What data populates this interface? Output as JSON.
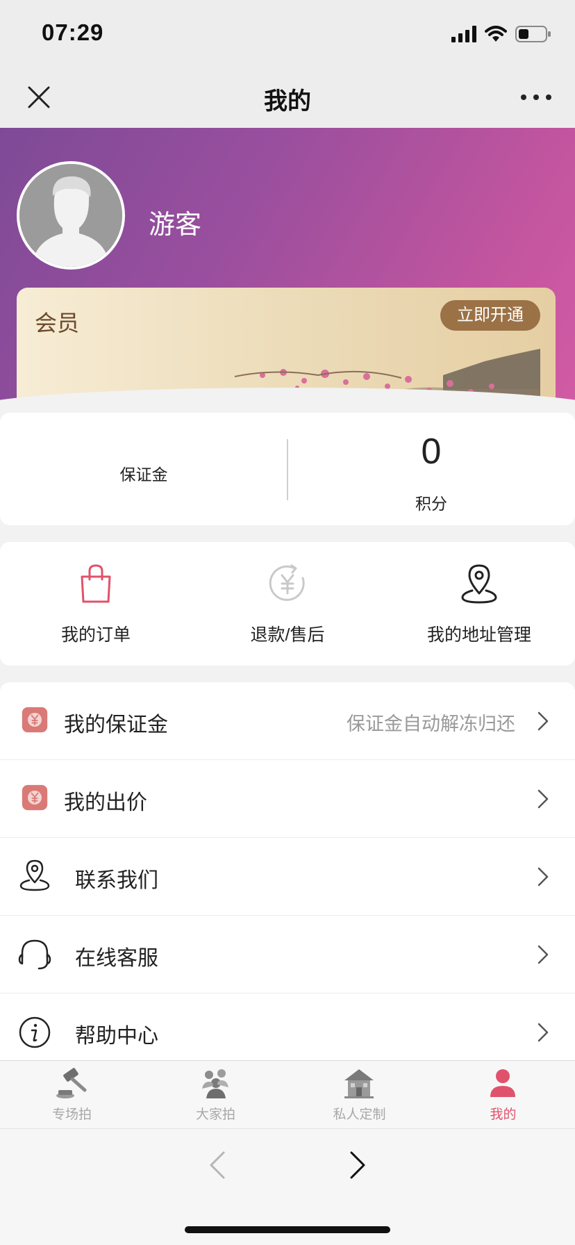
{
  "status_bar": {
    "time": "07:29"
  },
  "nav": {
    "title": "我的"
  },
  "profile": {
    "username": "游客"
  },
  "member_card": {
    "label": "会员",
    "button_label": "立即开通"
  },
  "stats": {
    "deposit": {
      "label": "保证金",
      "value": ""
    },
    "points": {
      "label": "积分",
      "value": "0"
    }
  },
  "quick_actions": [
    {
      "label": "我的订单",
      "icon": "shopping-bag-icon"
    },
    {
      "label": "退款/售后",
      "icon": "yen-refund-icon"
    },
    {
      "label": "我的地址管理",
      "icon": "location-pin-icon"
    }
  ],
  "menu": [
    {
      "label": "我的保证金",
      "subtitle": "保证金自动解冻归还",
      "icon": "yen-wallet-icon"
    },
    {
      "label": "我的出价",
      "subtitle": "",
      "icon": "yen-bid-icon"
    },
    {
      "label": "联系我们",
      "subtitle": "",
      "icon": "location-pin-icon"
    },
    {
      "label": "在线客服",
      "subtitle": "",
      "icon": "headset-icon"
    },
    {
      "label": "帮助中心",
      "subtitle": "",
      "icon": "info-icon"
    }
  ],
  "tabs": [
    {
      "label": "专场拍",
      "icon": "auction-gavel-icon",
      "active": false
    },
    {
      "label": "大家拍",
      "icon": "people-group-icon",
      "active": false
    },
    {
      "label": "私人定制",
      "icon": "house-icon",
      "active": false
    },
    {
      "label": "我的",
      "icon": "user-icon",
      "active": true
    }
  ],
  "colors": {
    "header_gradient_start": "#7e4a97",
    "header_gradient_end": "#d15ba5",
    "accent_red": "#e0526b",
    "member_button": "#9b7246",
    "icon_red": "#d97a77"
  }
}
